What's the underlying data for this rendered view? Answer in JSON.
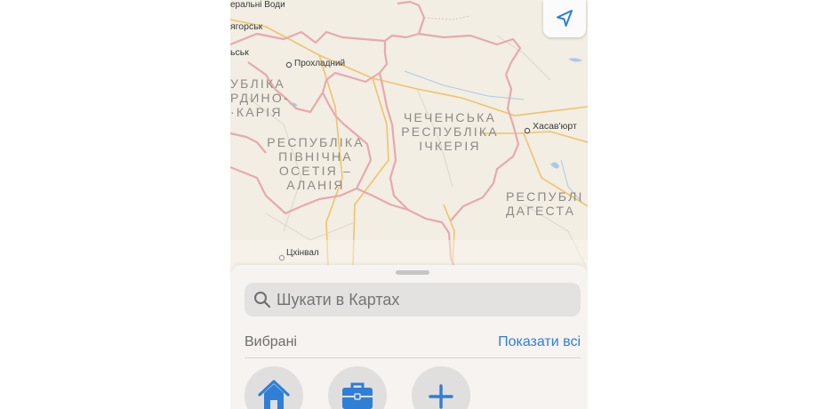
{
  "map": {
    "cities": {
      "mineralni_vody": "еральні Води",
      "pyatigorsk": "ягорськ",
      "cherkesk": "ьськ",
      "prokhladny": "Прохладний",
      "khasavyurt": "Хасав'юрт",
      "tskhinval": "Цхінвал"
    },
    "regions": {
      "kbr": [
        "УБЛІКА",
        "РДИНО-",
        "·КАРІЯ"
      ],
      "north_ossetia": [
        "РЕСПУБЛІКА",
        "ПІВНІЧНА",
        "ОСЕТІЯ –",
        "АЛАНІЯ"
      ],
      "chechnya": [
        "ЧЕЧЕНСЬКА",
        "РЕСПУБЛІКА",
        "ІЧКЕРІЯ"
      ],
      "dagestan": [
        "РЕСПУБЛІ",
        "ДАГЕСТА"
      ]
    },
    "colors": {
      "land": "#f2eee3",
      "border": "#e7a9ad",
      "road": "#f0c36a",
      "water": "#a9cbe8"
    }
  },
  "locate_button": {
    "icon": "location-arrow-icon"
  },
  "sheet": {
    "search": {
      "placeholder": "Шукати в Картах",
      "icon": "search-icon"
    },
    "favorites": {
      "title": "Вибрані",
      "show_all": "Показати всі",
      "items": [
        {
          "icon": "home-icon"
        },
        {
          "icon": "briefcase-icon"
        },
        {
          "icon": "plus-icon"
        }
      ]
    }
  },
  "accent_color": "#2f7fd6"
}
